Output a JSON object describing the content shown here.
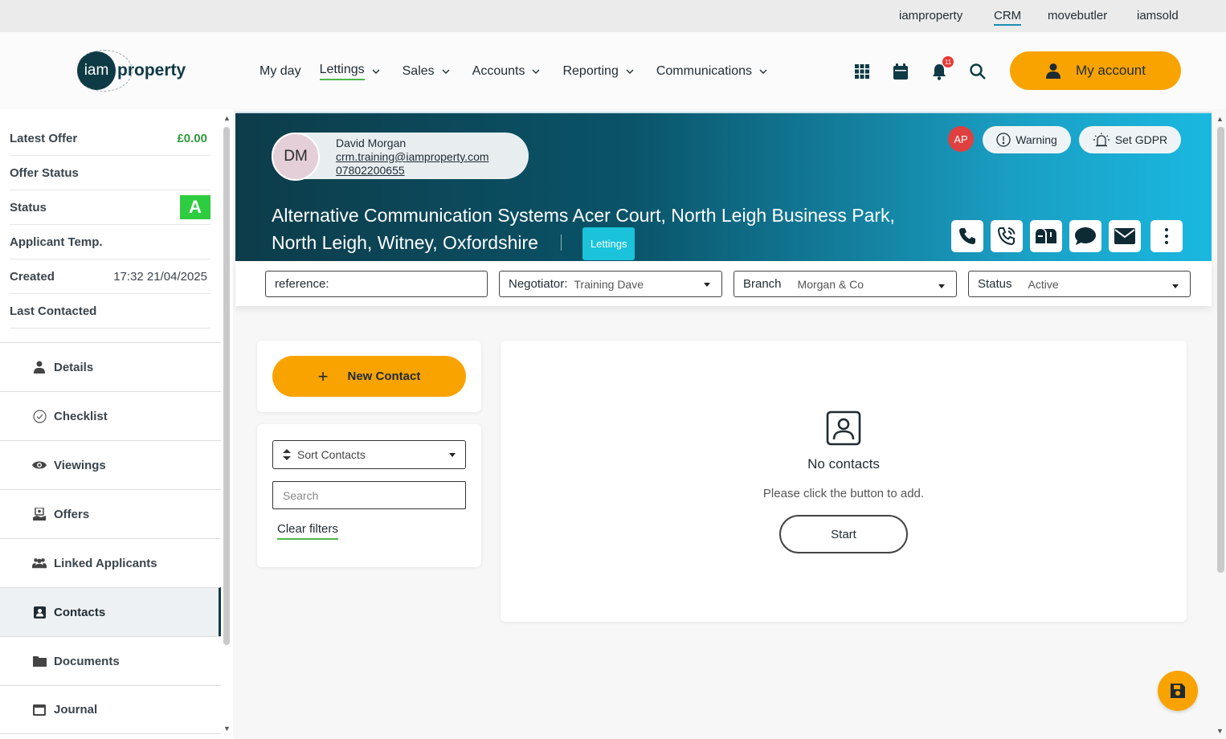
{
  "topbar": {
    "links": [
      {
        "label": "iamproperty",
        "active": false
      },
      {
        "label": "CRM",
        "active": true
      },
      {
        "label": "movebutler",
        "active": false
      },
      {
        "label": "iamsold",
        "active": false
      }
    ]
  },
  "header": {
    "logo": {
      "mark": "iam",
      "text": "property"
    },
    "nav": [
      {
        "label": "My day",
        "dropdown": false,
        "active": false
      },
      {
        "label": "Lettings",
        "dropdown": true,
        "active": true
      },
      {
        "label": "Sales",
        "dropdown": true,
        "active": false
      },
      {
        "label": "Accounts",
        "dropdown": true,
        "active": false
      },
      {
        "label": "Reporting",
        "dropdown": true,
        "active": false
      },
      {
        "label": "Communications",
        "dropdown": true,
        "active": false
      }
    ],
    "icons": [
      "apps-grid-icon",
      "calendar-icon",
      "bell-icon",
      "search-icon"
    ],
    "notification_count": "11",
    "my_account_label": "My account"
  },
  "sidebar": {
    "info": [
      {
        "label": "Latest Offer",
        "value": "£0.00"
      },
      {
        "label": "Offer Status",
        "value": ""
      },
      {
        "label": "Status",
        "value": "A"
      },
      {
        "label": "Applicant Temp.",
        "value": ""
      },
      {
        "label": "Created",
        "value": "17:32 21/04/2025"
      },
      {
        "label": "Last Contacted",
        "value": ""
      }
    ],
    "menu": [
      {
        "label": "Details",
        "icon": "person-icon",
        "active": false
      },
      {
        "label": "Checklist",
        "icon": "check-circle-icon",
        "active": false
      },
      {
        "label": "Viewings",
        "icon": "eye-icon",
        "active": false
      },
      {
        "label": "Offers",
        "icon": "offer-icon",
        "active": false
      },
      {
        "label": "Linked Applicants",
        "icon": "users-icon",
        "active": false
      },
      {
        "label": "Contacts",
        "icon": "contact-card-icon",
        "active": true
      },
      {
        "label": "Documents",
        "icon": "folder-icon",
        "active": false
      },
      {
        "label": "Journal",
        "icon": "journal-icon",
        "active": false
      }
    ]
  },
  "banner": {
    "contact": {
      "initials": "DM",
      "name": "David Morgan",
      "email": "crm.training@iamproperty.com",
      "phone": "07802200655"
    },
    "address_line1": "Alternative Communication Systems Acer Court, North Leigh Business Park,",
    "address_line2": "North Leigh, Witney, Oxfordshire",
    "tag": "Lettings",
    "user_initials": "AP",
    "warning_label": "Warning",
    "gdpr_label": "Set GDPR",
    "actions": [
      "phone-icon",
      "phone-call-icon",
      "mailbox-icon",
      "chat-icon",
      "email-icon",
      "more-vertical-icon"
    ]
  },
  "filters": {
    "reference_label": "reference:",
    "negotiator_label": "Negotiator:",
    "negotiator_value": "Training Dave",
    "branch_label": "Branch",
    "branch_value": "Morgan & Co",
    "status_label": "Status",
    "status_value": "Active"
  },
  "contacts_panel": {
    "new_contact_label": "New Contact",
    "sort_label": "Sort Contacts",
    "search_placeholder": "Search",
    "clear_filters_label": "Clear filters",
    "empty_title": "No contacts",
    "empty_subtitle": "Please click the button to add.",
    "start_label": "Start"
  },
  "colors": {
    "accent": "#f9a300",
    "brand_dark": "#0e3a45",
    "status_green": "#2ecc40",
    "tag_cyan": "#1ac3d9"
  }
}
